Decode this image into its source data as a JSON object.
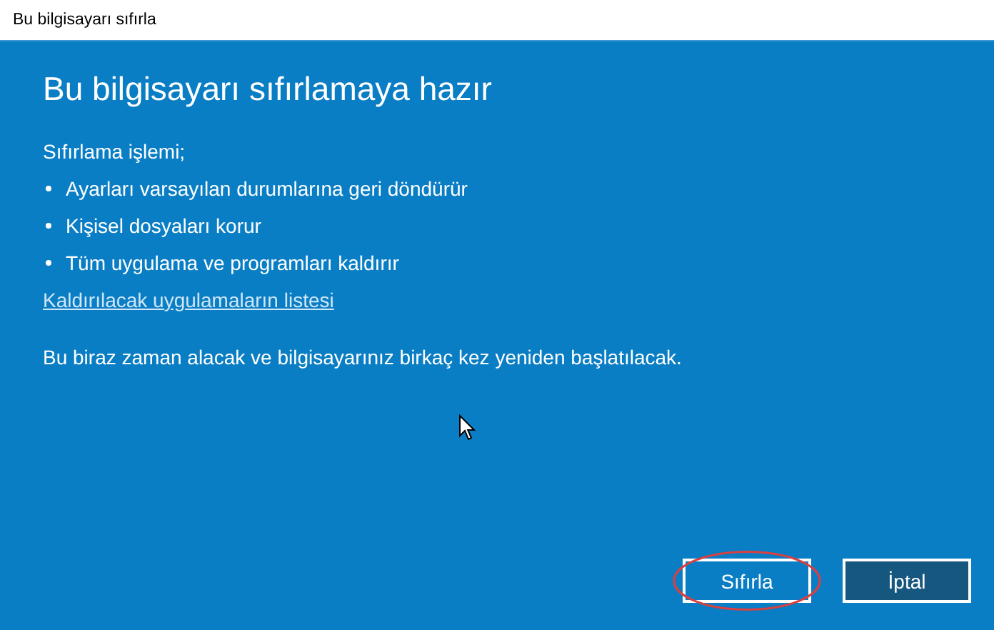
{
  "window": {
    "title": "Bu bilgisayarı sıfırla"
  },
  "heading": "Bu bilgisayarı sıfırlamaya hazır",
  "intro": "Sıfırlama işlemi;",
  "effects": [
    "Ayarları varsayılan durumlarına geri döndürür",
    "Kişisel dosyaları korur",
    "Tüm uygulama ve programları kaldırır"
  ],
  "link": "Kaldırılacak uygulamaların listesi",
  "note": "Bu biraz zaman alacak ve bilgisayarınız birkaç kez yeniden başlatılacak.",
  "buttons": [
    {
      "label": "Sıfırla",
      "kind": "primary",
      "circled": true
    },
    {
      "label": "İptal",
      "kind": "secondary",
      "circled": false
    }
  ]
}
